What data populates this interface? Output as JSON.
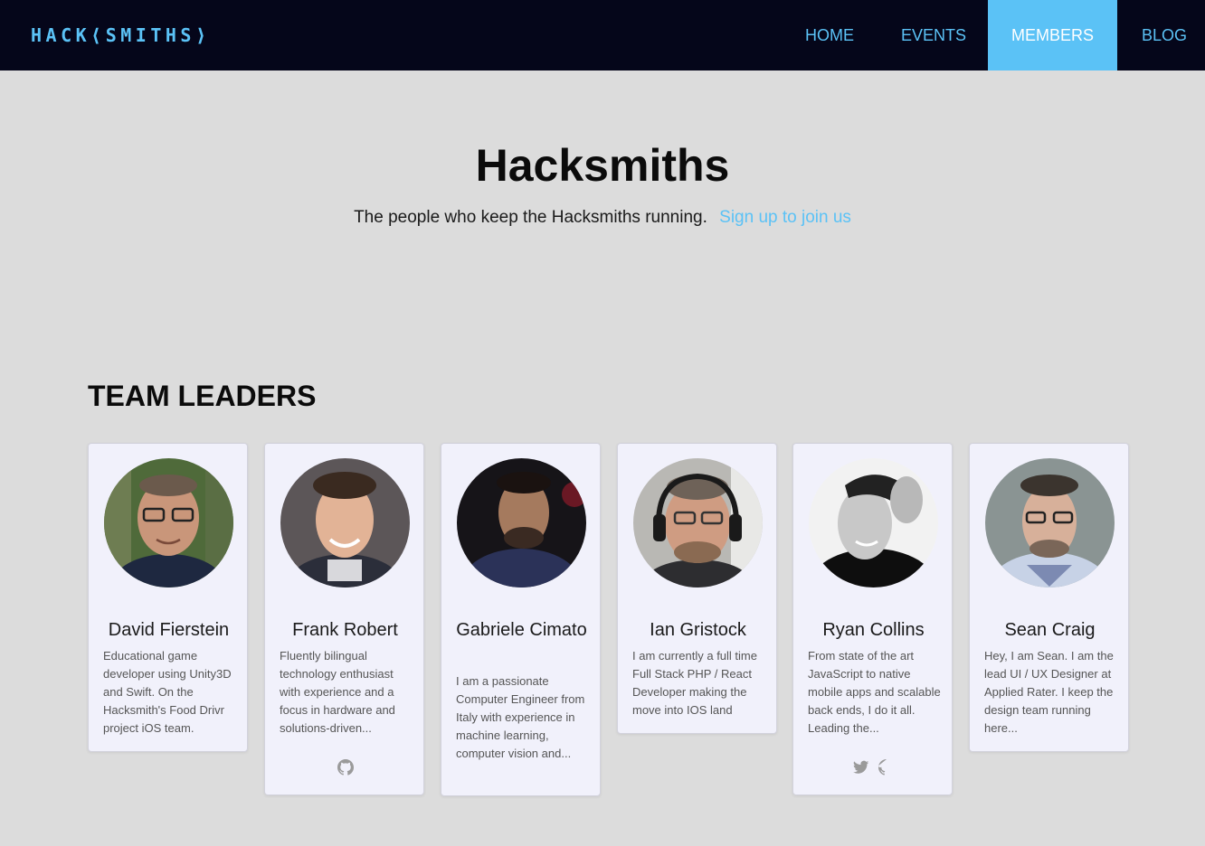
{
  "nav": {
    "logo": "HACK⟨SMITHS⟩",
    "items": [
      {
        "label": "HOME"
      },
      {
        "label": "EVENTS"
      },
      {
        "label": "MEMBERS"
      },
      {
        "label": "BLOG"
      }
    ],
    "active": "MEMBERS"
  },
  "hero": {
    "title": "Hacksmiths",
    "subtitle": "The people who keep the Hacksmiths running.",
    "signup_link": "Sign up to join us"
  },
  "section": {
    "title": "TEAM LEADERS"
  },
  "members": [
    {
      "name": "David Fierstein",
      "bio": "Educational game developer using Unity3D and Swift. On the Hacksmith's Food Drivr project iOS team.",
      "socials": []
    },
    {
      "name": "Frank Robert",
      "bio": "Fluently bilingual technology enthusiast with experience and a focus in hardware and solutions-driven...",
      "socials": [
        "github-icon"
      ]
    },
    {
      "name": "Gabriele Cimato",
      "bio": "I am a passionate Computer Engineer from Italy with experience in machine learning, computer vision and...",
      "socials": []
    },
    {
      "name": "Ian Gristock",
      "bio": "I am currently a full time Full Stack PHP / React Developer making the move into IOS land",
      "socials": []
    },
    {
      "name": "Ryan Collins",
      "bio": "From state of the art JavaScript to native mobile apps and scalable back ends, I do it all. Leading the...",
      "socials": [
        "twitter-icon",
        "github-icon"
      ]
    },
    {
      "name": "Sean Craig",
      "bio": "Hey, I am Sean. I am the lead UI / UX Designer at Applied Rater. I keep the design team running here...",
      "socials": []
    }
  ],
  "colors": {
    "navbar_bg": "#05061a",
    "accent": "#5bc2f6",
    "page_bg": "#dcdcdc",
    "card_bg": "#f1f1fb"
  }
}
